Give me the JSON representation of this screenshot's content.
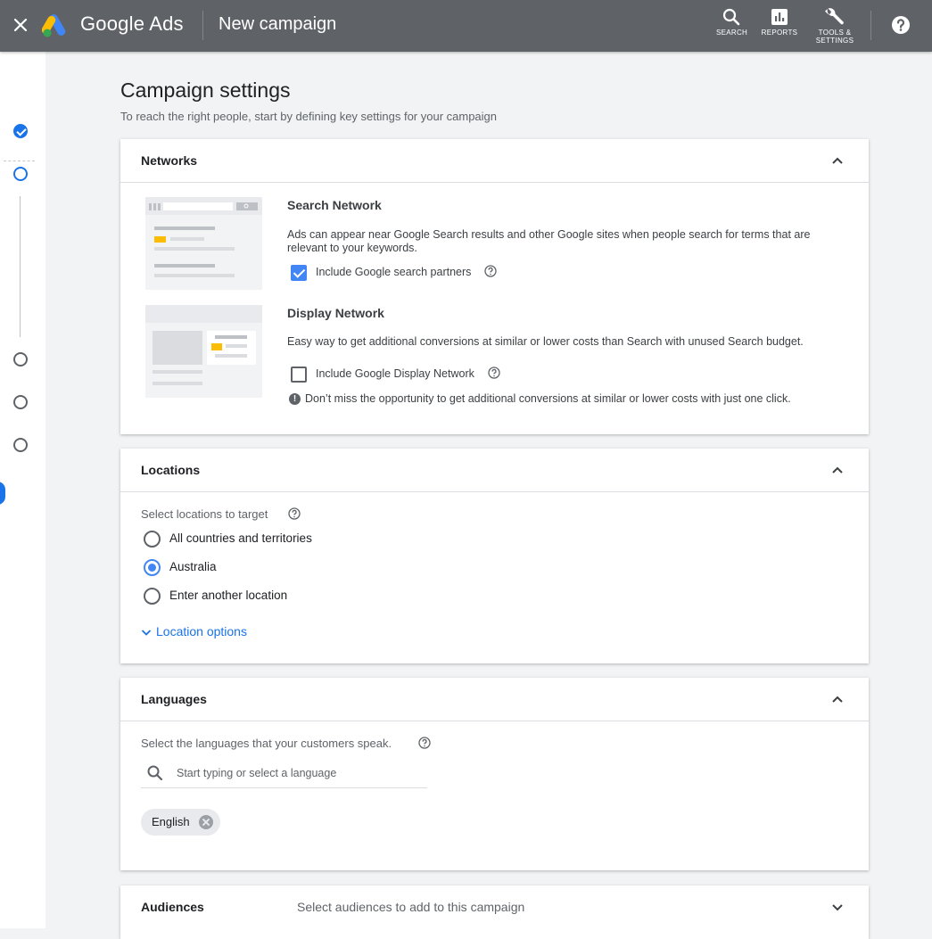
{
  "topbar": {
    "brand": "Google Ads",
    "title": "New campaign",
    "actions": {
      "search": "SEARCH",
      "reports": "REPORTS",
      "tools_line1": "TOOLS &",
      "tools_line2": "SETTINGS"
    }
  },
  "page": {
    "title": "Campaign settings",
    "subtitle": "To reach the right people, start by defining key settings for your campaign"
  },
  "networks": {
    "title": "Networks",
    "search": {
      "title": "Search Network",
      "description": "Ads can appear near Google Search results and other Google sites when people search for terms that are relevant to your keywords.",
      "option_label": "Include Google search partners",
      "checked": true
    },
    "display": {
      "title": "Display Network",
      "description": "Easy way to get additional conversions at similar or lower costs than Search with unused Search budget.",
      "option_label": "Include Google Display Network",
      "checked": false,
      "notice": "Don’t miss the opportunity to get additional conversions at similar or lower costs with just one click."
    }
  },
  "locations": {
    "title": "Locations",
    "label": "Select locations to target",
    "options": [
      "All countries and territories",
      "Australia",
      "Enter another location"
    ],
    "selected": "Australia",
    "more_link": "Location options"
  },
  "languages": {
    "title": "Languages",
    "label": "Select the languages that your customers speak.",
    "search_placeholder": "Start typing or select a language",
    "selected": [
      "English"
    ]
  },
  "audiences": {
    "title": "Audiences",
    "description": "Select audiences to add to this campaign"
  },
  "colors": {
    "topbar": "#5f6368",
    "accent": "#1a73e8",
    "checkbox": "#4285f4",
    "ad_highlight": "#fbbc04"
  }
}
